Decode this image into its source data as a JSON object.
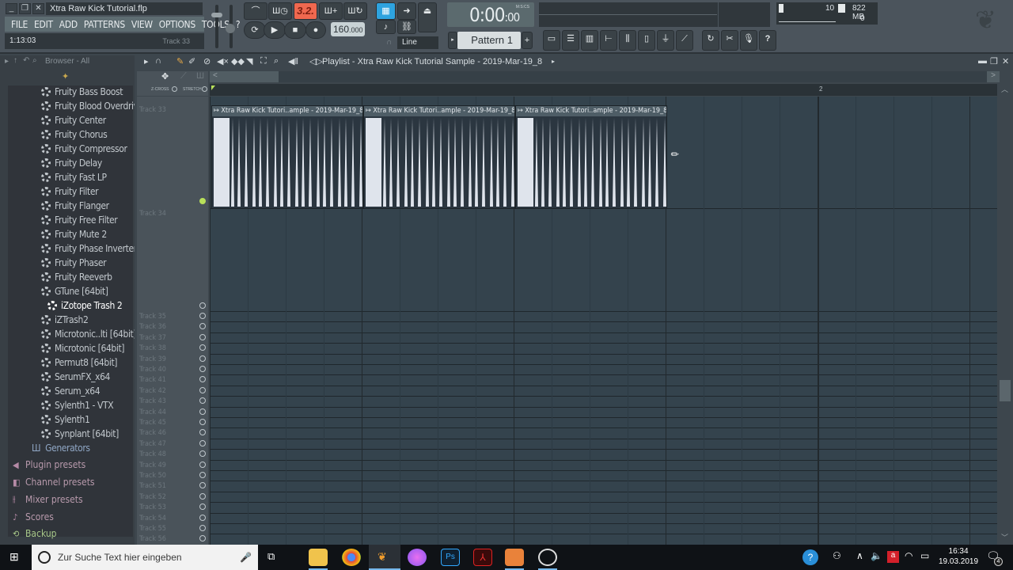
{
  "window": {
    "title": "Xtra Raw Kick Tutorial.flp",
    "controls": [
      "minimize",
      "restore",
      "close"
    ]
  },
  "menu": [
    "FILE",
    "EDIT",
    "ADD",
    "PATTERNS",
    "VIEW",
    "OPTIONS",
    "TOOLS",
    "?"
  ],
  "hint_bar": {
    "time": "1:13:03",
    "context": "Track 33"
  },
  "transport": {
    "pattern_song_label": "3.2.",
    "tempo_int": "160",
    "tempo_dec": ".000",
    "time_main": "0:00",
    "time_sub": "00",
    "time_mode_label": "M:S:CS",
    "snap_label": "Line",
    "pattern_name": "Pattern 1",
    "pattern_add": "+"
  },
  "monitor": {
    "polyphony": "10",
    "memory": "822 MB",
    "cpu": "0"
  },
  "browser": {
    "header": "Browser - All",
    "plugins": [
      {
        "label": "Fruity Bass Boost"
      },
      {
        "label": "Fruity Blood Overdrive"
      },
      {
        "label": "Fruity Center"
      },
      {
        "label": "Fruity Chorus"
      },
      {
        "label": "Fruity Compressor"
      },
      {
        "label": "Fruity Delay"
      },
      {
        "label": "Fruity Fast LP"
      },
      {
        "label": "Fruity Filter"
      },
      {
        "label": "Fruity Flanger"
      },
      {
        "label": "Fruity Free Filter"
      },
      {
        "label": "Fruity Mute 2"
      },
      {
        "label": "Fruity Phase Inverter"
      },
      {
        "label": "Fruity Phaser"
      },
      {
        "label": "Fruity Reeverb"
      },
      {
        "label": "GTune [64bit]"
      },
      {
        "label": "iZotope Trash 2",
        "selected": true
      },
      {
        "label": "iZTrash2"
      },
      {
        "label": "Microtonic..lti [64bit]"
      },
      {
        "label": "Microtonic [64bit]"
      },
      {
        "label": "Permut8 [64bit]"
      },
      {
        "label": "SerumFX_x64"
      },
      {
        "label": "Serum_x64"
      },
      {
        "label": "Sylenth1 - VTX"
      },
      {
        "label": "Sylenth1"
      },
      {
        "label": "Synplant [64bit]"
      }
    ],
    "generators_label": "Generators",
    "categories": [
      {
        "label": "Plugin presets",
        "icon": "speaker-icon",
        "color": "#b89aac"
      },
      {
        "label": "Channel presets",
        "icon": "channel-icon",
        "color": "#b89aac"
      },
      {
        "label": "Mixer presets",
        "icon": "mixer-icon",
        "color": "#b89aac"
      },
      {
        "label": "Scores",
        "icon": "note-icon",
        "color": "#b89aac"
      },
      {
        "label": "Backup",
        "icon": "backup-icon",
        "color": "#a8c98a"
      }
    ]
  },
  "playlist": {
    "title": "Playlist - Xtra Raw Kick Tutorial Sample - 2019-Mar-19_8",
    "xcross_label": "Z-CROSS",
    "stretch_label": "STRETCH",
    "ruler_bar": "2",
    "clips": [
      {
        "label": "Xtra Raw Kick Tutori..ample - 2019-Mar-19_8"
      },
      {
        "label": "Xtra Raw Kick Tutori..ample - 2019-Mar-19_8"
      },
      {
        "label": "Xtra Raw Kick Tutori..ample - 2019-Mar-19_8"
      }
    ],
    "tracks": [
      "Track 33",
      "Track 34",
      "Track 35",
      "Track 36",
      "Track 37",
      "Track 38",
      "Track 39",
      "Track 40",
      "Track 41",
      "Track 42",
      "Track 43",
      "Track 44",
      "Track 45",
      "Track 46",
      "Track 47",
      "Track 48",
      "Track 49",
      "Track 50",
      "Track 51",
      "Track 52",
      "Track 53",
      "Track 54",
      "Track 55",
      "Track 56"
    ]
  },
  "taskbar": {
    "search_placeholder": "Zur Suche Text hier eingeben",
    "apps": [
      "File Explorer",
      "Chrome",
      "FL Studio",
      "iTunes",
      "Photoshop",
      "Acrobat",
      "Video player",
      "OBS"
    ],
    "time": "16:34",
    "date": "19.03.2019",
    "notifications": "4"
  }
}
